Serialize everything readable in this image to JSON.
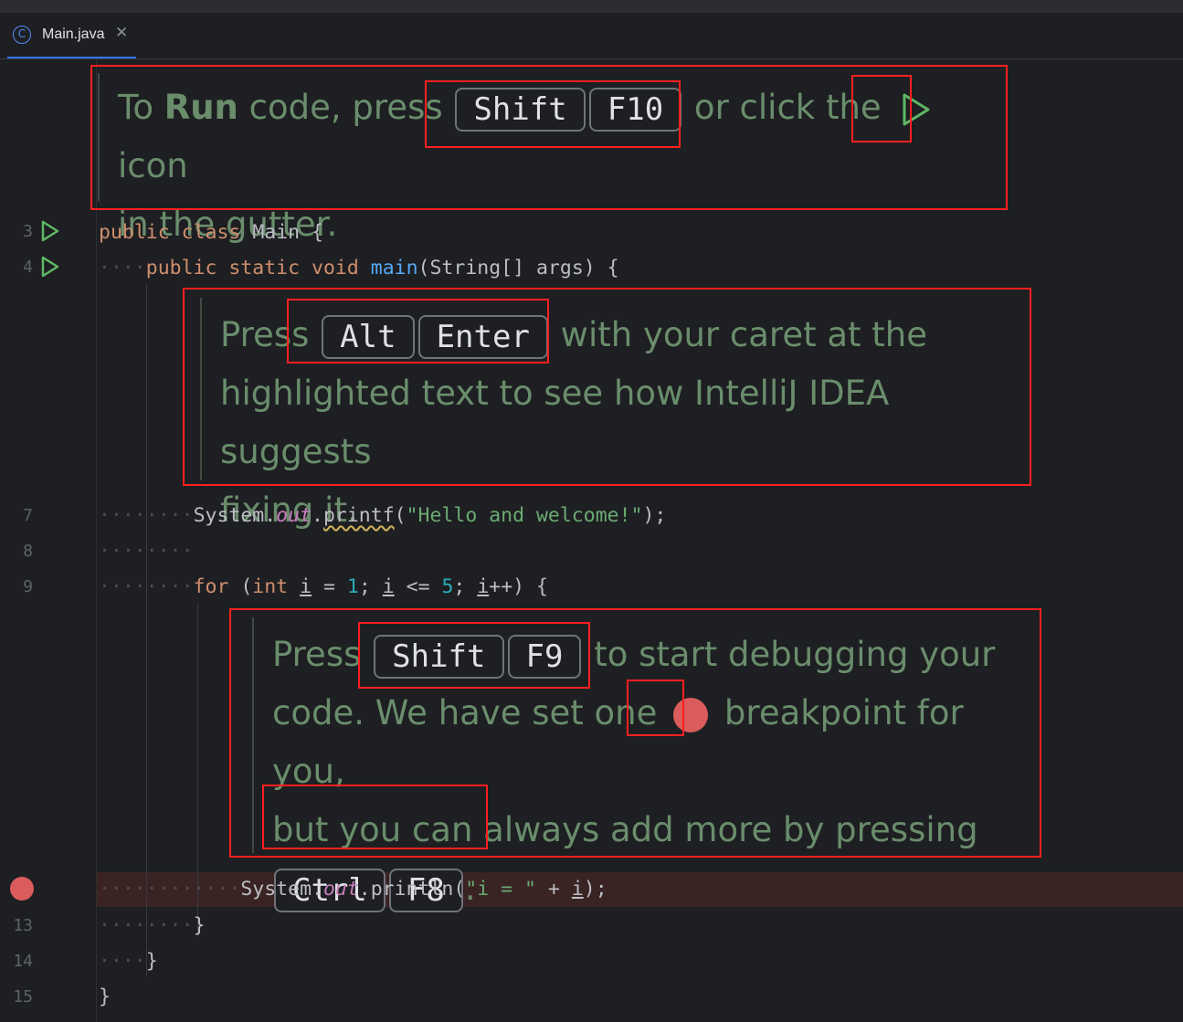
{
  "tab": {
    "icon": "class-icon",
    "icon_glyph": "C",
    "label": "Main.java",
    "close_glyph": "✕"
  },
  "gutter": {
    "line_numbers": {
      "l3": "3",
      "l4": "4",
      "l7": "7",
      "l8": "8",
      "l9": "9",
      "l13": "13",
      "l14": "14",
      "l15": "15"
    },
    "run_icon": "play-icon",
    "breakpoint_icon": "breakpoint-icon"
  },
  "docs": {
    "run": {
      "pre": "To ",
      "bold": "Run",
      "mid": " code, press ",
      "keys": [
        "Shift",
        "F10"
      ],
      "post1": " or click the ",
      "post2": " icon",
      "line2": "in the gutter."
    },
    "intention": {
      "pre": "Press ",
      "keys": [
        "Alt",
        "Enter"
      ],
      "post": " with your caret at the",
      "line2": "highlighted text to see how IntelliJ IDEA suggests",
      "line3": "fixing it."
    },
    "debug": {
      "pre": "Press ",
      "keys": [
        "Shift",
        "F9"
      ],
      "post": " to start debugging your",
      "line2a": "code. We have set one ",
      "line2b": " breakpoint for you,",
      "line3": "but you can always add more by pressing",
      "keys2": [
        "Ctrl",
        "F8"
      ],
      "end": "."
    }
  },
  "code": {
    "l3": {
      "kw1": "public",
      "kw2": "class",
      "name": "Main",
      "brace": "{"
    },
    "l4": {
      "kw1": "public",
      "kw2": "static",
      "kw3": "void",
      "fn": "main",
      "params": "(String[] args)",
      "brace": "{"
    },
    "l7": {
      "obj": "System.",
      "field": "out",
      "dot": ".",
      "method": "printf",
      "open": "(",
      "str": "\"Hello and welcome!\"",
      "close": ");"
    },
    "l9": {
      "kw": "for",
      "p1": " (",
      "type": "int",
      "v1": "i",
      "eq": " = ",
      "n1": "1",
      "semi1": "; ",
      "v2": "i",
      "le": " <= ",
      "n2": "5",
      "semi2": "; ",
      "v3": "i",
      "inc": "++) {"
    },
    "l12": {
      "obj": "System.",
      "field": "out",
      "rest": ".println(",
      "str": "\"i = \"",
      "plus": " + ",
      "v": "i",
      "close": ");"
    },
    "l13": "}",
    "l14": "}",
    "l15": "}"
  },
  "colors": {
    "keyword": "#cf8e6d",
    "function": "#56a8f5",
    "string": "#6aab73",
    "number": "#2aacb8",
    "field": "#c77dbb",
    "doc": "#6a8d6c",
    "highlight": "#ff2020",
    "breakpoint": "#db5c5c",
    "run": "#5fb865"
  }
}
